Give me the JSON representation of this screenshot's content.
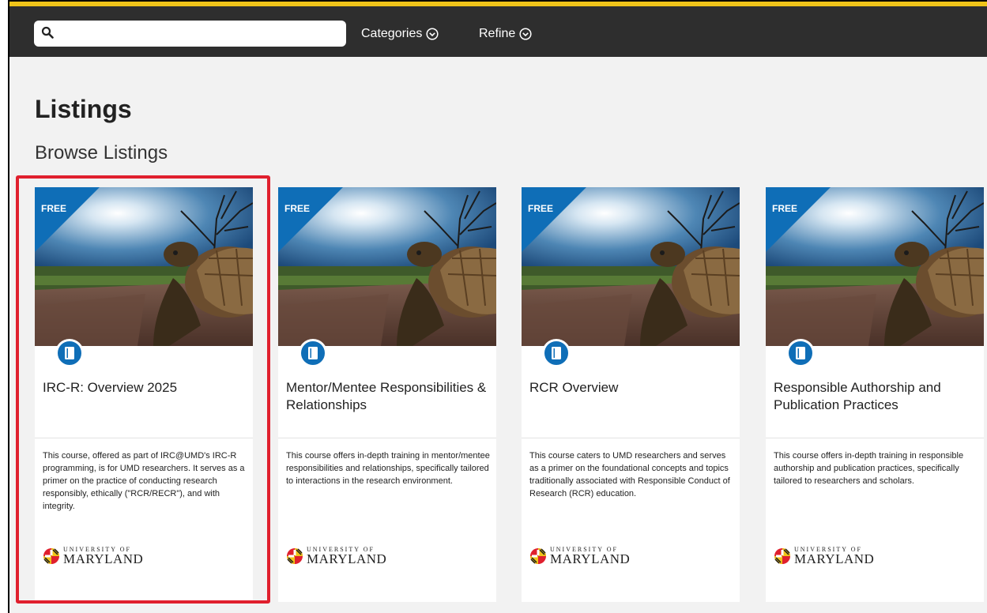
{
  "header": {
    "search_placeholder": "",
    "nav": [
      {
        "label": "Categories"
      },
      {
        "label": "Refine"
      }
    ]
  },
  "page": {
    "title": "Listings",
    "subtitle": "Browse Listings"
  },
  "cards": [
    {
      "badge": "FREE",
      "title": "IRC-R: Overview 2025",
      "description": "This course, offered as part of IRC@UMD's IRC-R programming, is for UMD researchers. It serves as a primer on the practice of conducting research responsibly, ethically (\"RCR/RECR\"), and with integrity.",
      "logo_top": "UNIVERSITY OF",
      "logo_main": "MARYLAND"
    },
    {
      "badge": "FREE",
      "title": "Mentor/Mentee Responsibilities & Relationships",
      "description": "This course offers in-depth training in mentor/mentee responsibilities and relationships, specifically tailored to interactions in the research environment.",
      "logo_top": "UNIVERSITY OF",
      "logo_main": "MARYLAND"
    },
    {
      "badge": "FREE",
      "title": "RCR Overview",
      "description": "This course caters to UMD researchers and serves as a primer on the foundational concepts and topics traditionally associated with Responsible Conduct of Research (RCR) education.",
      "logo_top": "UNIVERSITY OF",
      "logo_main": "MARYLAND"
    },
    {
      "badge": "FREE",
      "title": "Responsible Authorship and Publication Practices",
      "description": "This course offers in-depth training in responsible authorship and publication practices, specifically tailored to researchers and scholars.",
      "logo_top": "UNIVERSITY OF",
      "logo_main": "MARYLAND"
    }
  ],
  "colors": {
    "gold": "#f0c419",
    "topbar": "#2e2e2e",
    "badge_blue": "#0f6eb7",
    "highlight_red": "#e0202e"
  },
  "icons": [
    "search-icon",
    "chevron-down-circle-icon",
    "book-icon",
    "maryland-flag-icon"
  ]
}
